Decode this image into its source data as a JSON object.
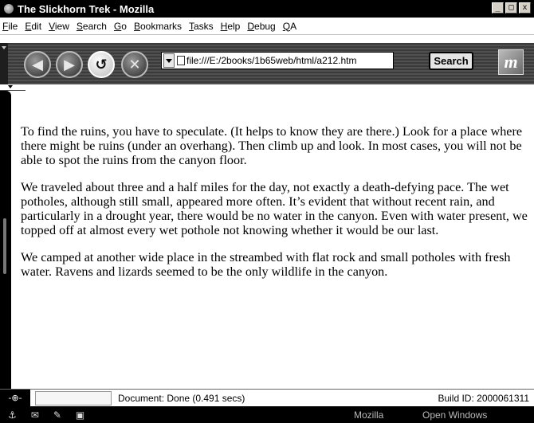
{
  "window": {
    "title": "The Slickhorn Trek - Mozilla",
    "minimize": "_",
    "maximize": "□",
    "close": "x"
  },
  "menu": [
    "File",
    "Edit",
    "View",
    "Search",
    "Go",
    "Bookmarks",
    "Tasks",
    "Help",
    "Debug",
    "QA"
  ],
  "toolbar": {
    "back_glyph": "◀",
    "forward_glyph": "▶",
    "reload_glyph": "↺",
    "stop_glyph": "✕",
    "url": "file:///E:/2books/1b65web/html/a212.htm",
    "search_label": "Search",
    "logo_text": "m"
  },
  "content": {
    "paragraphs": [
      "To find the ruins, you have to speculate. (It helps to know they are there.) Look for a place where there might be ruins (under an overhang). Then climb up and look. In most cases, you will not be able to spot the ruins from the canyon floor.",
      "We traveled about three and a half miles for the day, not exactly a death-defying pace. The wet potholes, although still small, appeared more often. It’s evident that without recent rain, and particularly in a drought year, there would be no water in the canyon. Even with water present, we topped off at almost every wet pothole not knowing whether it would be our last.",
      "We camped at another wide place in the streambed with flat rock and small potholes with fresh water. Ravens and lizards seemed to be the only wildlife in the canyon."
    ]
  },
  "status": {
    "text": "Document: Done (0.491 secs)",
    "build": "Build ID: 2000061311"
  },
  "taskbar": {
    "mozilla": "Mozilla",
    "open_windows": "Open Windows"
  }
}
